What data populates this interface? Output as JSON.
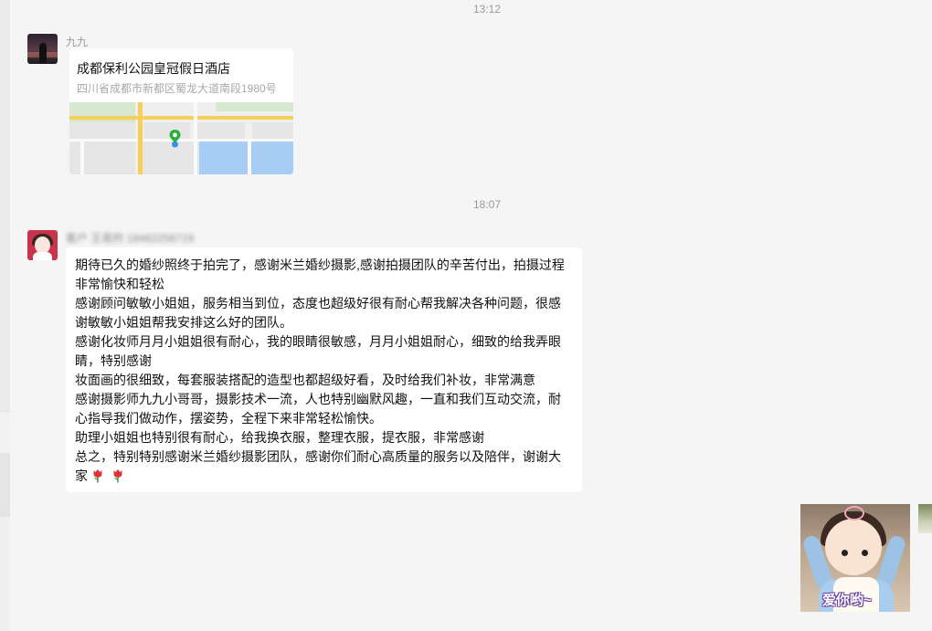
{
  "timestamps": [
    "13:12",
    "18:07"
  ],
  "messages": [
    {
      "sender": "九九",
      "type": "location",
      "title": "成都保利公园皇冠假日酒店",
      "address": "四川省成都市新都区蜀龙大道南段1980号"
    },
    {
      "sender": "客户 王易羚 18482258719",
      "type": "text",
      "lines": [
        "期待已久的婚纱照终于拍完了，感谢米兰婚纱摄影,感谢拍摄团队的辛苦付出，拍摄过程",
        "非常愉快和轻松",
        "感谢顾问敏敏小姐姐，服务相当到位，态度也超级好很有耐心帮我解决各种问题，很感",
        "谢敏敏小姐姐帮我安排这么好的团队。",
        "感谢化妆师月月小姐姐很有耐心，我的眼睛很敏感，月月小姐姐耐心，细致的给我弄眼",
        "睛，特别感谢",
        "妆面画的很细致，每套服装搭配的造型也都超级好看，及时给我们补妆，非常满意",
        " 感谢摄影师九九小哥哥，摄影技术一流，人也特别幽默风趣，一直和我们互动交流，耐",
        "心指导我们做动作，摆姿势，全程下来非常轻松愉快。",
        "助理小姐姐也特别很有耐心，给我换衣服，整理衣服，提衣服，非常感谢",
        "总之，特别特别感谢米兰婚纱摄影团队，感谢你们耐心高质量的服务以及陪伴，谢谢大",
        "家"
      ],
      "emoji": [
        "tulip",
        "tulip"
      ]
    },
    {
      "type": "sticker",
      "caption": "爱你哟~"
    }
  ],
  "colors": {
    "background": "#f5f5f5",
    "bubble": "#ffffff",
    "muted_text": "#9b9b9b",
    "map_road": "#f5cf5a",
    "map_water": "#a8cdf5",
    "pin": "#2aae3c"
  }
}
